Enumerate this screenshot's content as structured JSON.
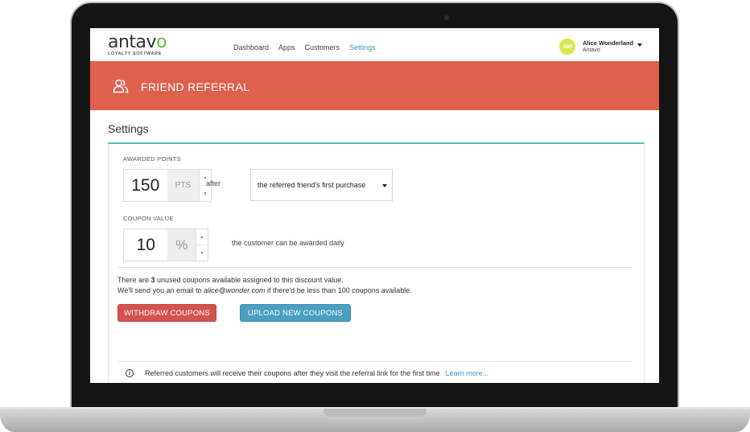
{
  "app": {
    "logo_text_main": "antav",
    "logo_text_last": "o",
    "logo_subtitle": "LOYALTY SOFTWARE",
    "accent_color": "#e0604e",
    "logo_color": "#6cbe45"
  },
  "nav": {
    "items": [
      {
        "label": "Dashboard"
      },
      {
        "label": "Apps"
      },
      {
        "label": "Customers"
      },
      {
        "label": "Settings"
      }
    ],
    "active": "Settings"
  },
  "user": {
    "initials": "AW",
    "name": "Alice Wonderland",
    "org": "Antavo"
  },
  "header": {
    "icon": "users-icon",
    "title": "FRIEND REFERRAL"
  },
  "settings": {
    "title": "Settings",
    "awarded_points": {
      "label": "AWARDED POINTS",
      "value": "150",
      "unit": "PTS",
      "after_text": "after",
      "trigger_selected": "the referred friend's first purchase"
    },
    "coupon_value": {
      "label": "COUPON VALUE",
      "value": "10",
      "unit": "%",
      "daily_text": "the customer can be awarded daily"
    },
    "coupons_info": {
      "line1_prefix": "There are ",
      "line1_count": "3",
      "line1_suffix": " unused coupons available assigned to this discount value.",
      "line2_prefix": "We'll send you an email to ",
      "line2_email": "alice@wonder.com",
      "line2_suffix": " if there'd be less than 100 coupons available."
    },
    "buttons": {
      "withdraw": "WITHDRAW COUPONS",
      "upload": "UPLOAD NEW COUPONS"
    },
    "notice": {
      "text": "Referred customers will receive their coupons after they visit the referral link for the first time",
      "link": "Learn more..."
    }
  }
}
